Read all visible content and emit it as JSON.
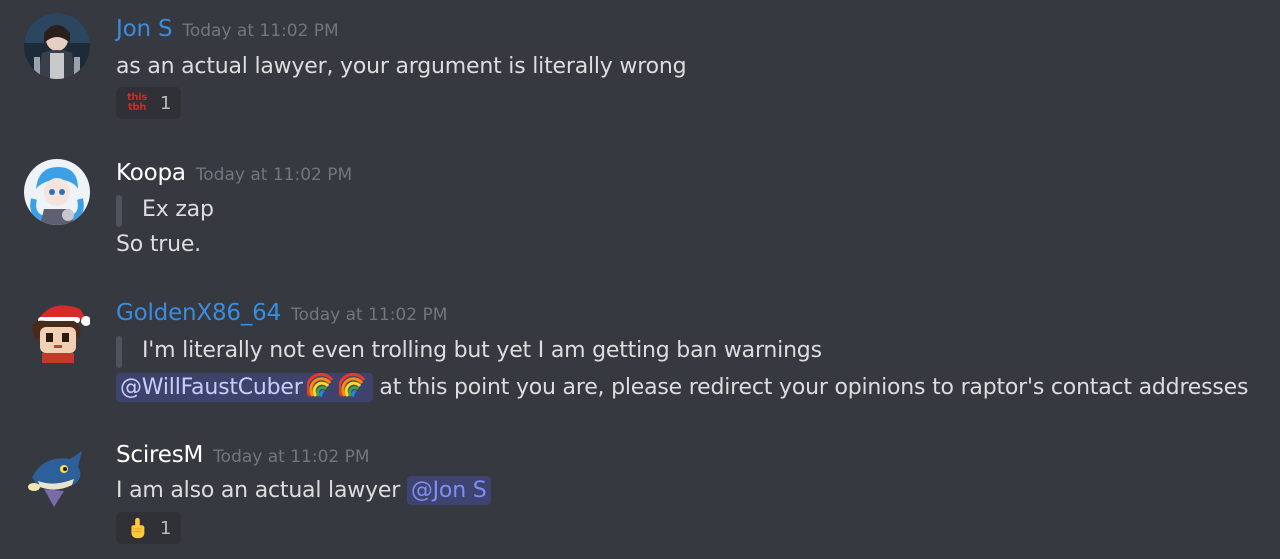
{
  "messages": [
    {
      "username": "Jon S",
      "username_color": "#3a8dde",
      "timestamp": "Today at 11:02 PM",
      "text": "as an actual lawyer, your argument is literally wrong",
      "reaction": {
        "emoji": "this tbh",
        "emoji_top": "this",
        "emoji_bottom": "tbh",
        "count": "1"
      }
    },
    {
      "username": "Koopa",
      "username_color": "#ffffff",
      "timestamp": "Today at 11:02 PM",
      "quote": "Ex zap",
      "text": "So true."
    },
    {
      "username": "GoldenX86_64",
      "username_color": "#3a8dde",
      "timestamp": "Today at 11:02 PM",
      "quote": "I'm literally not even trolling but yet I am getting ban warnings",
      "mention": "@WillFaustCuber",
      "mention_emojis": [
        "rainbow-icon",
        "rainbow-icon"
      ],
      "text": "at this point you are, please redirect your opinions to raptor's contact addresses"
    },
    {
      "username": "SciresM",
      "username_color": "#ffffff",
      "timestamp": "Today at 11:02 PM",
      "text": "I am also an actual lawyer",
      "mention": "@Jon S",
      "reaction": {
        "emoji": "index-pointing-up-icon",
        "count": "1"
      }
    }
  ],
  "colors": {
    "background": "#36393f",
    "text": "#dcddde",
    "timestamp": "#72767d",
    "mention_bg": "#414675",
    "mention_text": "#c9cdfb"
  }
}
